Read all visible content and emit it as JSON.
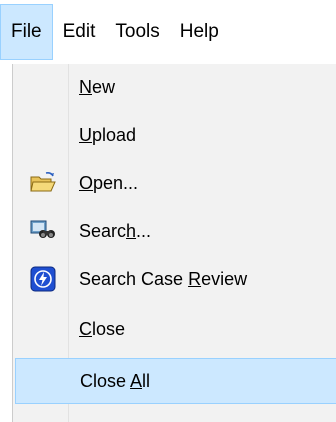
{
  "menubar": {
    "items": [
      {
        "label": "File",
        "active": true
      },
      {
        "label": "Edit"
      },
      {
        "label": "Tools"
      },
      {
        "label": "Help"
      }
    ]
  },
  "file_menu": {
    "items": [
      {
        "pre": "",
        "u": "N",
        "post": "ew",
        "icon": ""
      },
      {
        "pre": "",
        "u": "U",
        "post": "pload",
        "icon": ""
      },
      {
        "pre": "",
        "u": "O",
        "post": "pen...",
        "icon": "folder-open-icon"
      },
      {
        "pre": "Searc",
        "u": "h",
        "post": "...",
        "icon": "binoculars-search-icon"
      },
      {
        "pre": "Search Case ",
        "u": "R",
        "post": "eview",
        "icon": "case-review-shield-icon"
      },
      {
        "pre": "",
        "u": "C",
        "post": "lose",
        "icon": ""
      },
      {
        "pre": "Close ",
        "u": "A",
        "post": "ll",
        "icon": "",
        "highlighted": true
      }
    ]
  },
  "colors": {
    "highlight_bg": "#cce8ff",
    "highlight_border": "#99d1ff",
    "menu_bg": "#f2f2f2"
  }
}
